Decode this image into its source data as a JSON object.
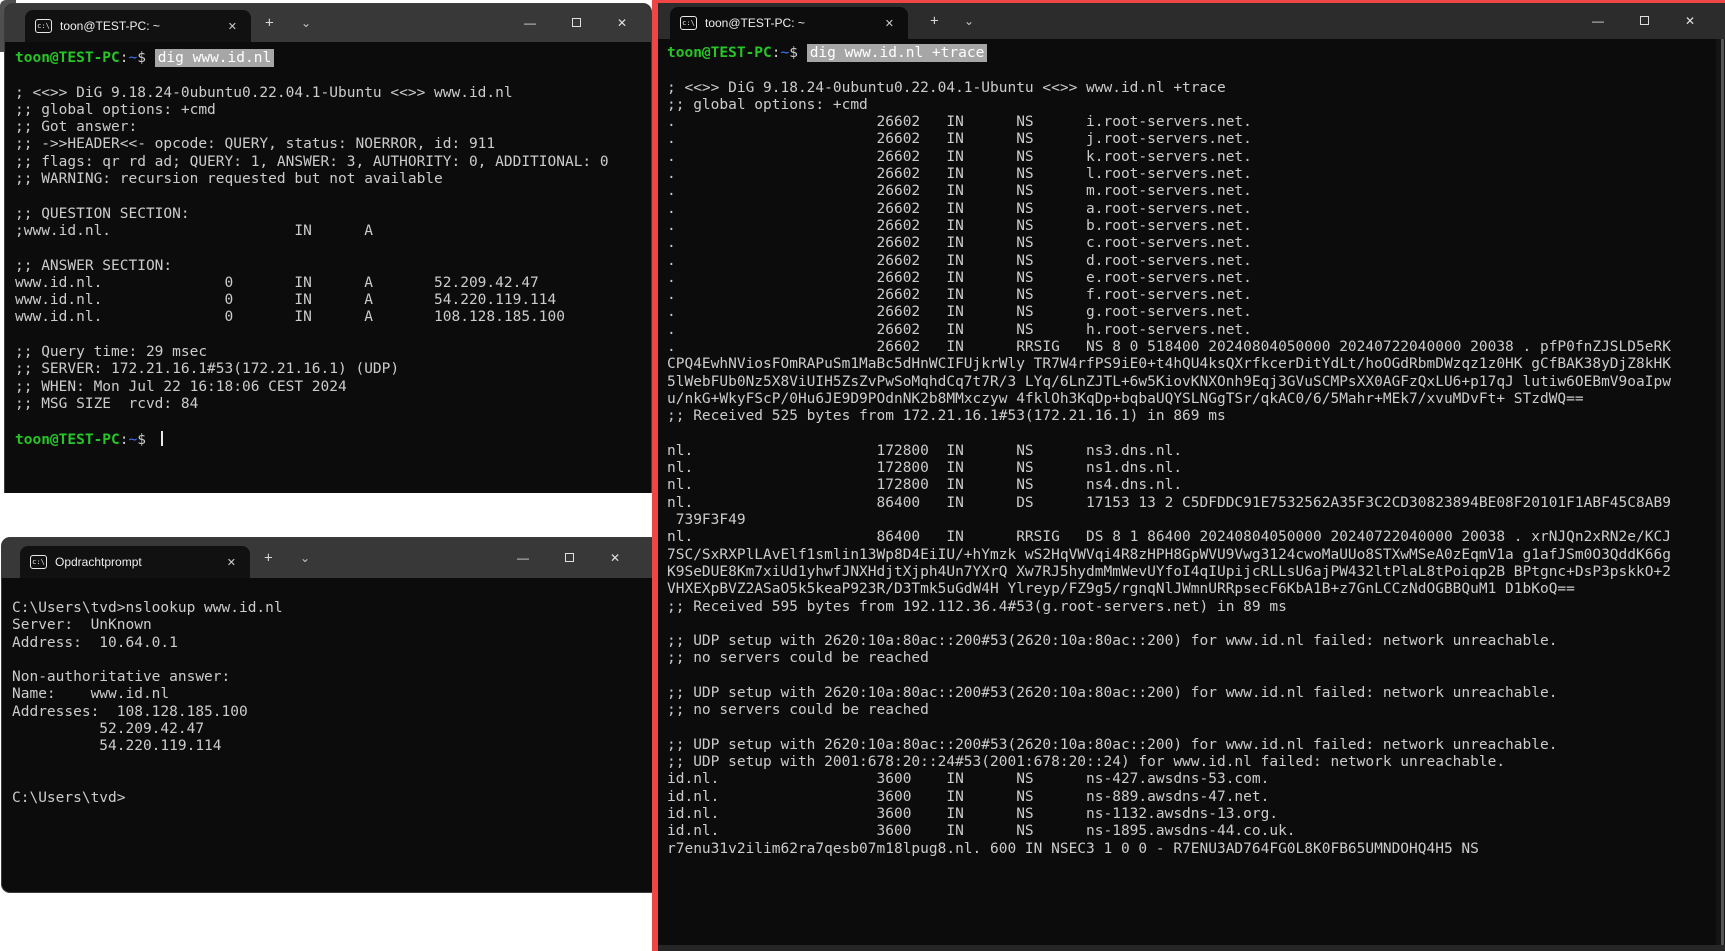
{
  "chrome": {
    "new_tab_glyph": "+",
    "dropdown_glyph": "⌄",
    "minimize_glyph": "—",
    "close_glyph": "✕",
    "tab_close_glyph": "✕",
    "cmd_icon_glyph": "c:\\"
  },
  "colors": {
    "terminal_background": "#0c0c0c",
    "titlebar_left_windows": "#383838",
    "titlebar_right_window": "#2c2c2c",
    "focus_border_red": "#ee4545",
    "prompt_green": "#26c626",
    "prompt_tilde_blue": "#3b78ff",
    "selection_background": "#a6a6a6",
    "text": "#cccccc"
  },
  "windows": {
    "wsl_dig": {
      "tab_title": "toon@TEST-PC: ~",
      "prompt": {
        "user_host": "toon@TEST-PC",
        "colon": ":",
        "cwd": "~",
        "dollar": "$ "
      },
      "command": "dig www.id.nl",
      "body": "\n\n; <<>> DiG 9.18.24-0ubuntu0.22.04.1-Ubuntu <<>> www.id.nl\n;; global options: +cmd\n;; Got answer:\n;; ->>HEADER<<- opcode: QUERY, status: NOERROR, id: 911\n;; flags: qr rd ad; QUERY: 1, ANSWER: 3, AUTHORITY: 0, ADDITIONAL: 0\n;; WARNING: recursion requested but not available\n\n;; QUESTION SECTION:\n;www.id.nl.                     IN      A\n\n;; ANSWER SECTION:\nwww.id.nl.              0       IN      A       52.209.42.47\nwww.id.nl.              0       IN      A       54.220.119.114\nwww.id.nl.              0       IN      A       108.128.185.100\n\n;; Query time: 29 msec\n;; SERVER: 172.21.16.1#53(172.21.16.1) (UDP)\n;; WHEN: Mon Jul 22 16:18:06 CEST 2024\n;; MSG SIZE  rcvd: 84\n\n"
    },
    "cmd": {
      "tab_title": "Opdrachtprompt",
      "body": "C:\\Users\\tvd>nslookup www.id.nl\nServer:  UnKnown\nAddress:  10.64.0.1\n\nNon-authoritative answer:\nName:    www.id.nl\nAddresses:  108.128.185.100\n          52.209.42.47\n          54.220.119.114\n\n\nC:\\Users\\tvd>"
    },
    "wsl_trace": {
      "tab_title": "toon@TEST-PC: ~",
      "prompt": {
        "user_host": "toon@TEST-PC",
        "colon": ":",
        "cwd": "~",
        "dollar": "$ "
      },
      "command": "dig www.id.nl +trace",
      "body": "\n\n; <<>> DiG 9.18.24-0ubuntu0.22.04.1-Ubuntu <<>> www.id.nl +trace\n;; global options: +cmd\n.                       26602   IN      NS      i.root-servers.net.\n.                       26602   IN      NS      j.root-servers.net.\n.                       26602   IN      NS      k.root-servers.net.\n.                       26602   IN      NS      l.root-servers.net.\n.                       26602   IN      NS      m.root-servers.net.\n.                       26602   IN      NS      a.root-servers.net.\n.                       26602   IN      NS      b.root-servers.net.\n.                       26602   IN      NS      c.root-servers.net.\n.                       26602   IN      NS      d.root-servers.net.\n.                       26602   IN      NS      e.root-servers.net.\n.                       26602   IN      NS      f.root-servers.net.\n.                       26602   IN      NS      g.root-servers.net.\n.                       26602   IN      NS      h.root-servers.net.\n.                       26602   IN      RRSIG   NS 8 0 518400 20240804050000 20240722040000 20038 . pfP0fnZJSLD5eRK\nCPQ4EwhNViosFOmRAPuSm1MaBc5dHnWCIFUjkrWly TR7W4rfPS9iE0+t4hQU4ksQXrfkcerDitYdLt/hoOGdRbmDWzqz1z0HK gCfBAK38yDjZ8kHK\n5lWebFUb0Nz5X8ViUIH5ZsZvPwSoMqhdCq7t7R/3 LYq/6LnZJTL+6w5KiovKNXOnh9Eqj3GVuSCMPsXX0AGFzQxLU6+p17qJ lutiw6OEBmV9oaIpw\nu/nkG+WkyFScP/0Hu6JE9D9POdnNK2b8MMxczyw 4fklOh3KqDp+bqbaUQYSLNGgTSr/qkAC0/6/5Mahr+MEk7/xvuMDvFt+ STzdWQ==\n;; Received 525 bytes from 172.21.16.1#53(172.21.16.1) in 869 ms\n\nnl.                     172800  IN      NS      ns3.dns.nl.\nnl.                     172800  IN      NS      ns1.dns.nl.\nnl.                     172800  IN      NS      ns4.dns.nl.\nnl.                     86400   IN      DS      17153 13 2 C5DFDDC91E7532562A35F3C2CD30823894BE08F20101F1ABF45C8AB9\n 739F3F49\nnl.                     86400   IN      RRSIG   DS 8 1 86400 20240804050000 20240722040000 20038 . xrNJQn2xRN2e/KCJ\n7SC/SxRXPlLAvElf1smlin13Wp8D4EiIU/+hYmzk wS2HqVWVqi4R8zHPH8GpWVU9Vwg3124cwoMaUUo8STXwMSeA0zEqmV1a g1afJSm0O3QddK66g\nK9SeDUE8Km7xiUd1yhwfJNXHdjtXjph4Un7YXrQ Xw7RJ5hydmMmWevUYfoI4qIUpijcRLLsU6ajPW432ltPlaL8tPoiqp2B BPtgnc+DsP3pskkO+2\nVHXEXpBVZ2ASaO5k5keaP923R/D3Tmk5uGdW4H Ylreyp/FZ9g5/rgnqNlJWmnURRpsecF6KbA1B+z7GnLCCzNdOGBBQuM1 D1bKoQ==\n;; Received 595 bytes from 192.112.36.4#53(g.root-servers.net) in 89 ms\n\n;; UDP setup with 2620:10a:80ac::200#53(2620:10a:80ac::200) for www.id.nl failed: network unreachable.\n;; no servers could be reached\n\n;; UDP setup with 2620:10a:80ac::200#53(2620:10a:80ac::200) for www.id.nl failed: network unreachable.\n;; no servers could be reached\n\n;; UDP setup with 2620:10a:80ac::200#53(2620:10a:80ac::200) for www.id.nl failed: network unreachable.\n;; UDP setup with 2001:678:20::24#53(2001:678:20::24) for www.id.nl failed: network unreachable.\nid.nl.                  3600    IN      NS      ns-427.awsdns-53.com.\nid.nl.                  3600    IN      NS      ns-889.awsdns-47.net.\nid.nl.                  3600    IN      NS      ns-1132.awsdns-13.org.\nid.nl.                  3600    IN      NS      ns-1895.awsdns-44.co.uk.\nr7enu31v2ilim62ra7qesb07m18lpug8.nl. 600 IN NSEC3 1 0 0 - R7ENU3AD764FG0L8K0FB65UMNDOHQ4H5 NS"
    }
  }
}
